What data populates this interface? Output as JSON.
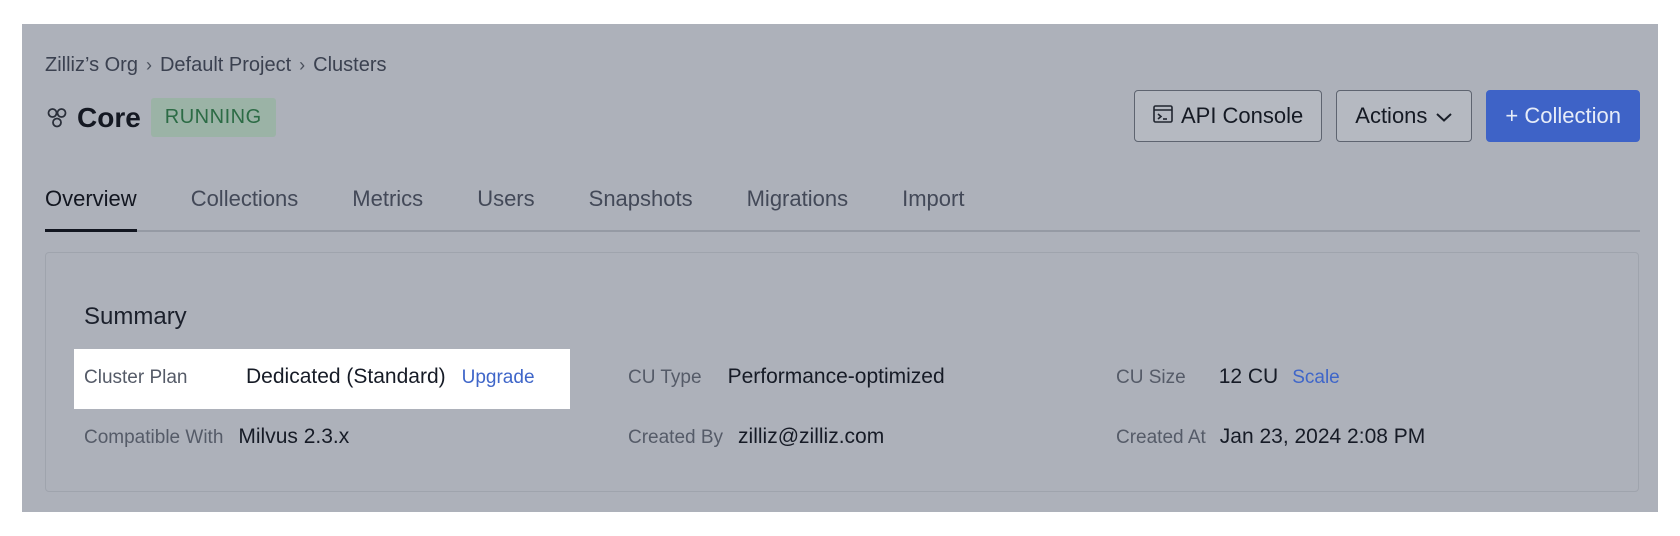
{
  "breadcrumb": {
    "items": [
      "Zilliz’s Org",
      "Default Project",
      "Clusters"
    ],
    "separator": "›"
  },
  "header": {
    "icon": "cluster-icon",
    "title": "Core",
    "status": "RUNNING",
    "status_color": "#2c6b45"
  },
  "actions": {
    "api_console_label": "API Console",
    "actions_label": "Actions",
    "add_collection_label": "+ Collection"
  },
  "tabs": [
    {
      "label": "Overview",
      "active": true
    },
    {
      "label": "Collections",
      "active": false
    },
    {
      "label": "Metrics",
      "active": false
    },
    {
      "label": "Users",
      "active": false
    },
    {
      "label": "Snapshots",
      "active": false
    },
    {
      "label": "Migrations",
      "active": false
    },
    {
      "label": "Import",
      "active": false
    }
  ],
  "summary": {
    "title": "Summary",
    "cluster_plan": {
      "label": "Cluster Plan",
      "value": "Dedicated (Standard)",
      "link": "Upgrade"
    },
    "cu_type": {
      "label": "CU Type",
      "value": "Performance-optimized"
    },
    "cu_size": {
      "label": "CU Size",
      "value": "12 CU",
      "link": "Scale"
    },
    "compatible_with": {
      "label": "Compatible With",
      "value": "Milvus 2.3.x"
    },
    "created_by": {
      "label": "Created By",
      "value": "zilliz@zilliz.com"
    },
    "created_at": {
      "label": "Created At",
      "value": "Jan 23, 2024 2:08 PM"
    }
  },
  "colors": {
    "overlay": "#adb1ba",
    "accent": "#3e63c7",
    "link": "#3f66c9"
  }
}
